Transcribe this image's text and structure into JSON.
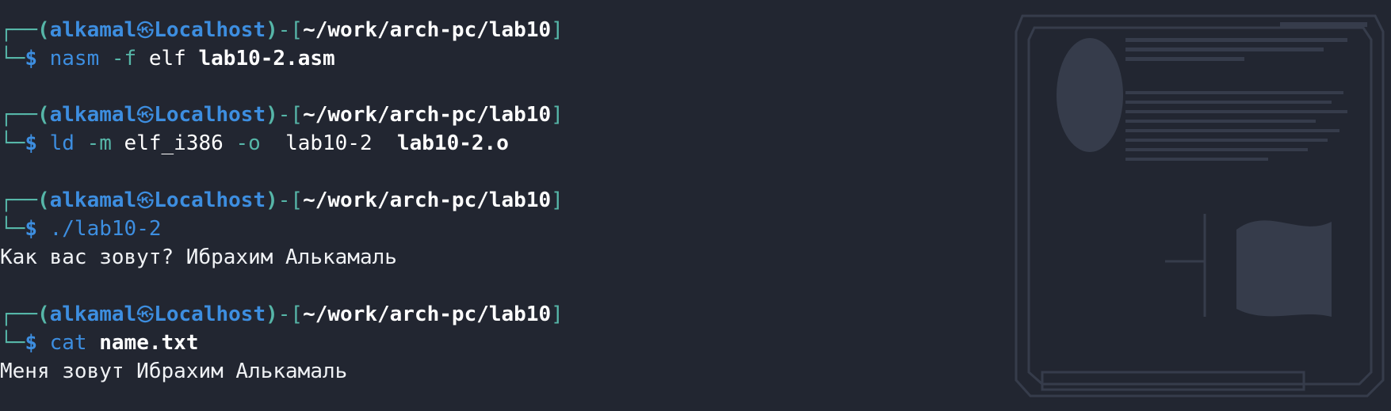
{
  "prompt": {
    "top_left": "┌──",
    "bottom_left": "└─",
    "open_paren": "(",
    "user": "alkamal",
    "separator_icon": "㉿",
    "host": "Localhost",
    "close_paren": ")",
    "dash": "-",
    "open_bracket": "[",
    "path": "~/work/arch-pc/lab10",
    "close_bracket": "]",
    "symbol": "$"
  },
  "blocks": [
    {
      "tokens": [
        {
          "text": "nasm",
          "style": "cmd"
        },
        {
          "text": " -f",
          "style": "flag"
        },
        {
          "text": " elf",
          "style": "arg"
        },
        {
          "text": " lab10-2.asm",
          "style": "argb"
        }
      ],
      "output": null
    },
    {
      "tokens": [
        {
          "text": "ld",
          "style": "cmd"
        },
        {
          "text": " -m",
          "style": "flag"
        },
        {
          "text": " elf_i386",
          "style": "arg"
        },
        {
          "text": " -o",
          "style": "flag"
        },
        {
          "text": "  lab10-2",
          "style": "arg"
        },
        {
          "text": "  lab10-2.o",
          "style": "argb"
        }
      ],
      "output": null
    },
    {
      "tokens": [
        {
          "text": "./lab10-2",
          "style": "cmd"
        }
      ],
      "output": "Как вас зовут? Ибрахим Алькамаль"
    },
    {
      "tokens": [
        {
          "text": "cat",
          "style": "cmd"
        },
        {
          "text": " name.txt",
          "style": "argb"
        }
      ],
      "output": "Меня зовут Ибрахим Алькамаль"
    }
  ],
  "colors": {
    "background": "#222631",
    "accent_blue": "#3d8ee0",
    "accent_teal": "#56b6a8",
    "text": "#f0f2f5"
  }
}
